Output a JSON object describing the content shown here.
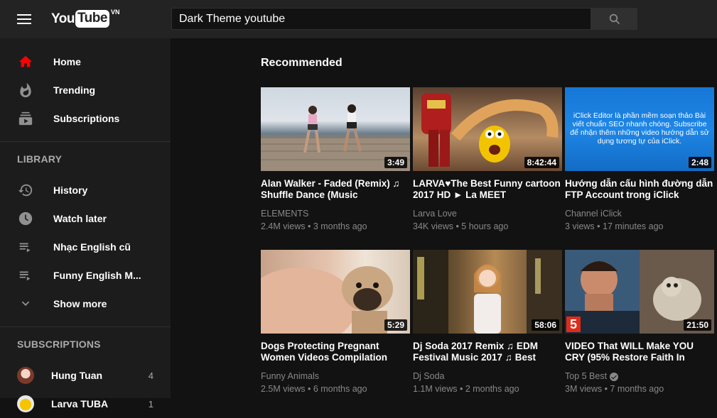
{
  "header": {
    "logo_you": "You",
    "logo_tube": "Tube",
    "logo_country": "VN",
    "search_value": "Dark Theme youtube"
  },
  "sidebar": {
    "main_items": [
      {
        "label": "Home",
        "icon": "home-icon"
      },
      {
        "label": "Trending",
        "icon": "trending-icon"
      },
      {
        "label": "Subscriptions",
        "icon": "subscriptions-icon"
      }
    ],
    "library_header": "LIBRARY",
    "library_items": [
      {
        "label": "History",
        "icon": "history-icon"
      },
      {
        "label": "Watch later",
        "icon": "watch-later-icon"
      },
      {
        "label": "Nhạc English cũ",
        "icon": "playlist-icon"
      },
      {
        "label": "Funny English M...",
        "icon": "playlist-icon"
      },
      {
        "label": "Show more",
        "icon": "chevron-down-icon"
      }
    ],
    "subscriptions_header": "SUBSCRIPTIONS",
    "subscriptions": [
      {
        "name": "Hung Tuan",
        "count": "4"
      },
      {
        "name": "Larva TUBA",
        "count": "1"
      }
    ]
  },
  "main": {
    "section_title": "Recommended",
    "videos": [
      {
        "title": "Alan Walker - Faded (Remix) ♫ Shuffle Dance (Music",
        "channel": "ELEMENTS",
        "meta": "2.4M views • 3 months ago",
        "duration": "3:49"
      },
      {
        "title": "LARVA♥The Best Funny cartoon 2017 HD ► La MEET",
        "channel": "Larva Love",
        "meta": "34K views • 5 hours ago",
        "duration": "8:42:44"
      },
      {
        "title": "Hướng dẫn cấu hình đường dẫn FTP Account trong iClick",
        "channel": "Channel iClick",
        "meta": "3 views • 17 minutes ago",
        "duration": "2:48",
        "thumb_text": "iClick Editor là phần mềm soạn thảo Bài viết chuẩn SEO nhanh chóng. Subscribe để nhận thêm những video hướng dẫn sử dụng tương tự của iClick."
      },
      {
        "title": "Dogs Protecting Pregnant Women Videos Compilation",
        "channel": "Funny Animals",
        "meta": "2.5M views • 6 months ago",
        "duration": "5:29"
      },
      {
        "title": "Dj Soda 2017 Remix ♫ EDM Festival Music 2017 ♫ Best",
        "channel": "Dj Soda",
        "meta": "1.1M views • 2 months ago",
        "duration": "58:06"
      },
      {
        "title": "VIDEO That WILL Make YOU CRY (95% Restore Faith In",
        "channel": "Top 5 Best",
        "meta": "3M views • 7 months ago",
        "duration": "21:50",
        "thumb_badge": "5"
      }
    ]
  },
  "colors": {
    "topbar": "#232323",
    "sidebar": "#1c1c1c",
    "background": "#121212",
    "accent_red": "#ff0000"
  }
}
